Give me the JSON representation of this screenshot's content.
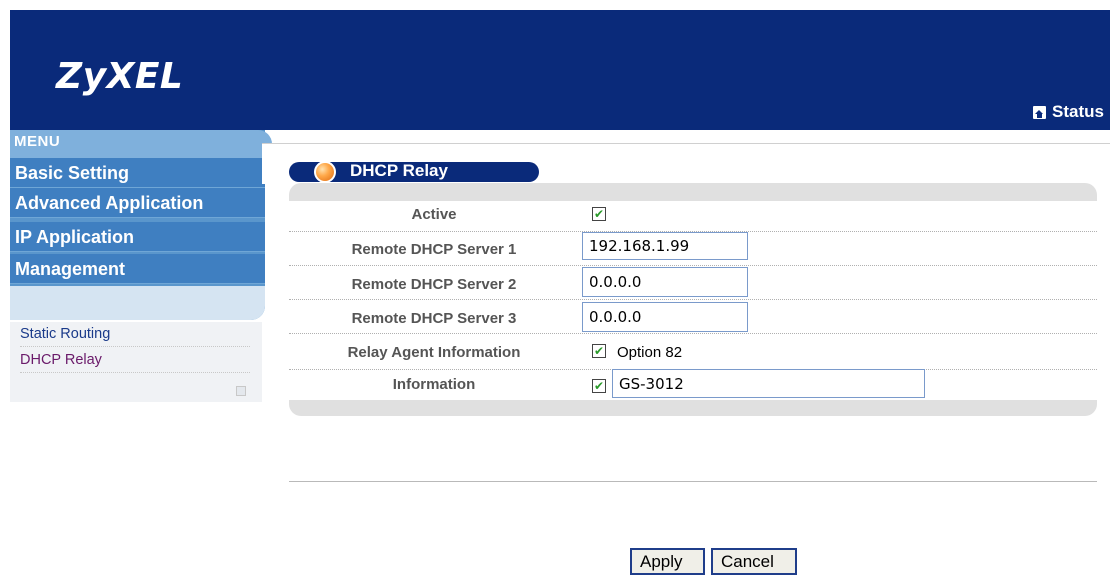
{
  "header": {
    "logo_text": "ZyXEL",
    "status_label": "Status"
  },
  "menu": {
    "title": "MENU",
    "items": [
      {
        "label": "Basic Setting"
      },
      {
        "label": "Advanced Application"
      },
      {
        "label": "IP Application"
      },
      {
        "label": "Management"
      }
    ],
    "sub_items": [
      {
        "label": "Static Routing",
        "color": "#1a3a8a"
      },
      {
        "label": "DHCP Relay",
        "color": "#6a1a6a"
      }
    ]
  },
  "panel": {
    "title": "DHCP Relay",
    "fields": {
      "active": {
        "label": "Active",
        "checked": true
      },
      "server1": {
        "label": "Remote DHCP Server 1",
        "value": "192.168.1.99"
      },
      "server2": {
        "label": "Remote DHCP Server 2",
        "value": "0.0.0.0"
      },
      "server3": {
        "label": "Remote DHCP Server 3",
        "value": "0.0.0.0"
      },
      "relay_agent": {
        "label": "Relay Agent Information",
        "checked": true,
        "option": "Option 82"
      },
      "information": {
        "label": "Information",
        "checked": true,
        "value": "GS-3012"
      }
    }
  },
  "buttons": {
    "apply": "Apply",
    "cancel": "Cancel"
  },
  "colors": {
    "header_bg": "#0a2a7a",
    "menu_item_bg": "#3f7fc1",
    "check_mark": "#2a9a2a"
  }
}
